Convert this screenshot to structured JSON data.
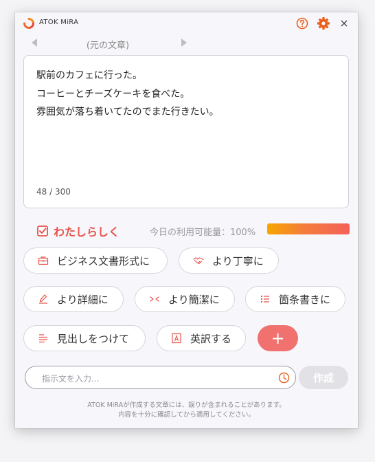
{
  "app": {
    "title": "ATOK MiRA"
  },
  "nav": {
    "label": "(元の文章)"
  },
  "editor": {
    "lines": [
      "駅前のカフェに行った。",
      "コーヒーとチーズケーキを食べた。",
      "雰囲気が落ち着いてたのでまた行きたい。"
    ],
    "counter": "48 / 300"
  },
  "toggle": {
    "label": "わたしらしく",
    "checked": true
  },
  "usage": {
    "text": "今日の利用可能量：100%",
    "percent": 100
  },
  "actions": {
    "business": "ビジネス文書形式に",
    "polite": "より丁寧に",
    "detailed": "より詳細に",
    "concise": "より簡潔に",
    "bullets": "箇条書きに",
    "heading": "見出しをつけて",
    "translate": "英訳する",
    "add": "+"
  },
  "instruction": {
    "placeholder": "指示文を入力..."
  },
  "create": {
    "label": "作成"
  },
  "disclaimer": {
    "line1": "ATOK MiRAが作成する文章には、誤りが含まれることがあります。",
    "line2": "内容を十分に確認してから適用してください。"
  },
  "colors": {
    "accent": "#e8524a",
    "icon": "#e8601c",
    "plus": "#f0716d"
  }
}
